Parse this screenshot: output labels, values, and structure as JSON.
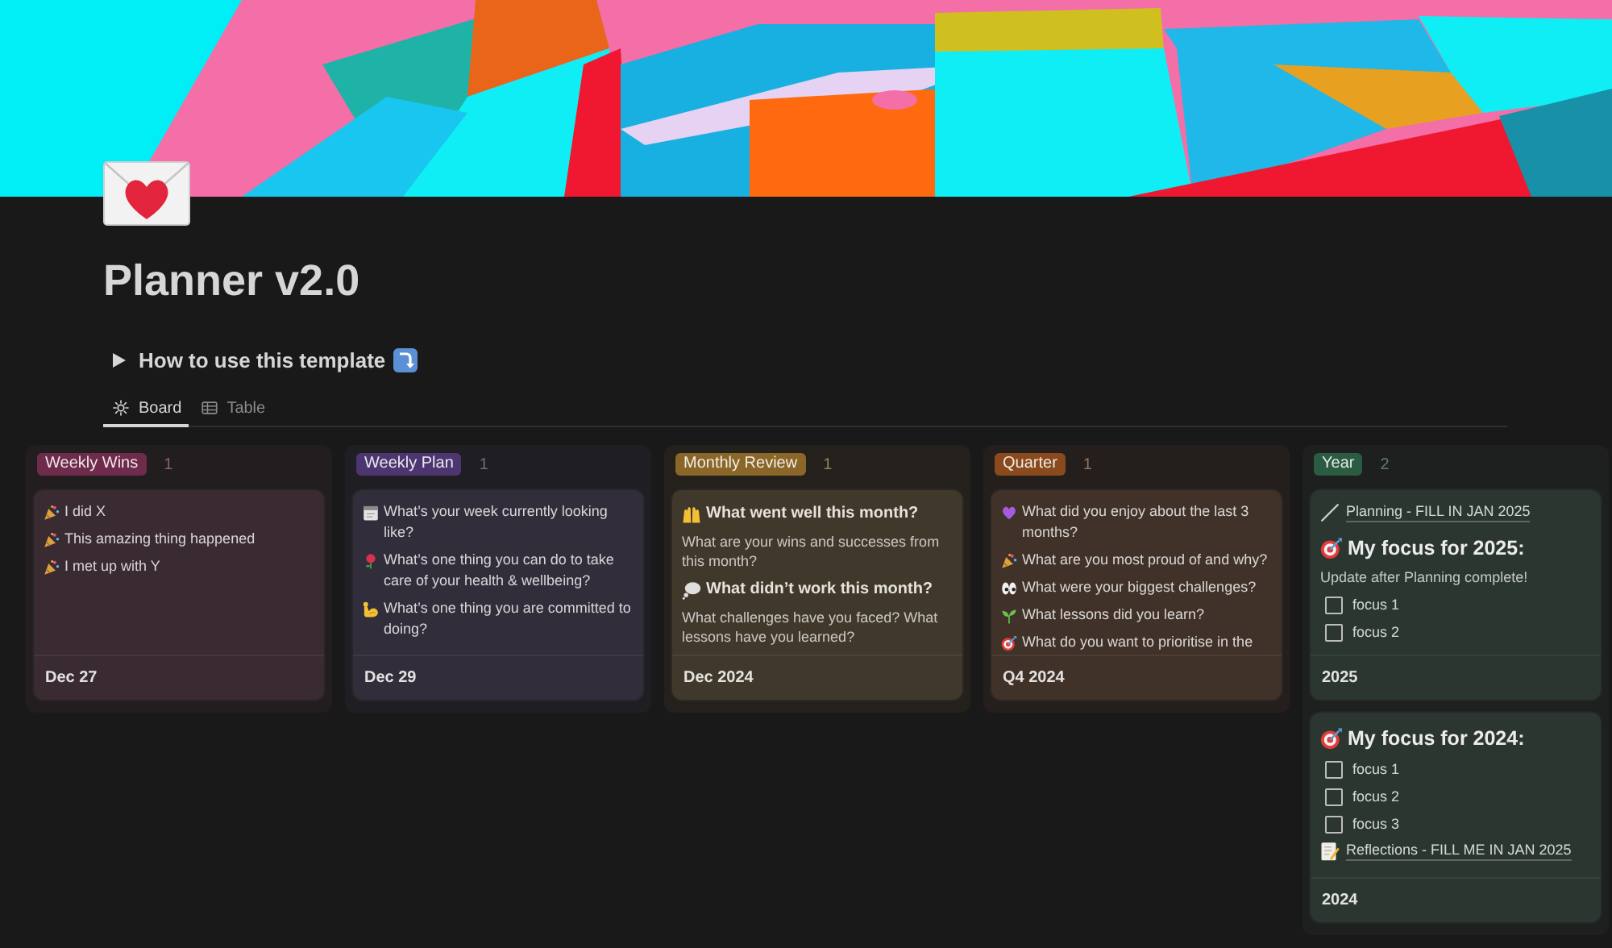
{
  "page": {
    "title": "Planner v2.0",
    "toggle": {
      "label": "How to use this template",
      "expanded": false
    }
  },
  "views": [
    {
      "label": "Board",
      "selected": true
    },
    {
      "label": "Table",
      "selected": false
    }
  ],
  "board": {
    "groups": [
      {
        "label": "Weekly Wins",
        "count": "1",
        "color": "#6f2b4b",
        "cards": [
          {
            "blocks": [
              {
                "kind": "bullet",
                "text": "I did X"
              },
              {
                "kind": "bullet",
                "text": "This amazing thing happened"
              },
              {
                "kind": "bullet",
                "text": "I met up with Y"
              }
            ],
            "date": "Dec 27"
          }
        ]
      },
      {
        "label": "Weekly Plan",
        "count": "1",
        "color": "#4d3670",
        "cards": [
          {
            "blocks": [
              {
                "kind": "bullet",
                "text": "What’s your week currently looking like?"
              },
              {
                "kind": "bullet",
                "text": "What’s one thing you can do to take care of your health & wellbeing?"
              },
              {
                "kind": "bullet",
                "text": "What’s one thing you are committed to doing?"
              }
            ],
            "date": "Dec 29"
          }
        ]
      },
      {
        "label": "Monthly Review",
        "count": "1",
        "color": "#8a6628",
        "cards": [
          {
            "blocks": [
              {
                "kind": "subheading",
                "text": "What went well this month?"
              },
              {
                "kind": "text",
                "text": "What are your wins and successes from this month?"
              },
              {
                "kind": "subheading",
                "text": "What didn’t work this month?"
              },
              {
                "kind": "text",
                "text": "What challenges have you faced? What lessons have you learned?"
              }
            ],
            "date": "Dec 2024"
          }
        ]
      },
      {
        "label": "Quarter",
        "count": "1",
        "color": "#8a4a1e",
        "cards": [
          {
            "blocks": [
              {
                "kind": "bullet",
                "text": "What did you enjoy about the last 3 months?"
              },
              {
                "kind": "bullet",
                "text": "What are you most proud of and why?"
              },
              {
                "kind": "bullet",
                "text": "What were your biggest challenges?"
              },
              {
                "kind": "bullet",
                "text": "What lessons did you learn?"
              },
              {
                "kind": "bullet",
                "text": "What do you want to prioritise in the"
              }
            ],
            "date": "Q4 2024"
          }
        ]
      },
      {
        "label": "Year",
        "count": "2",
        "color": "#2b5b41",
        "cards": [
          {
            "blocks": [
              {
                "kind": "link",
                "text": "Planning - FILL IN JAN 2025"
              },
              {
                "kind": "heading",
                "text": "My focus for 2025:"
              },
              {
                "kind": "text",
                "text": "Update after Planning complete!"
              },
              {
                "kind": "todo",
                "text": "focus 1",
                "checked": false
              },
              {
                "kind": "todo",
                "text": "focus 2",
                "checked": false
              }
            ],
            "date": "2025"
          },
          {
            "blocks": [
              {
                "kind": "heading",
                "text": "My focus for 2024:"
              },
              {
                "kind": "todo",
                "text": "focus 1",
                "checked": false
              },
              {
                "kind": "todo",
                "text": "focus 2",
                "checked": false
              },
              {
                "kind": "todo",
                "text": "focus 3",
                "checked": false
              },
              {
                "kind": "link",
                "text": "Reflections - FILL ME IN JAN 2025"
              }
            ],
            "date": "2024"
          }
        ]
      }
    ]
  }
}
